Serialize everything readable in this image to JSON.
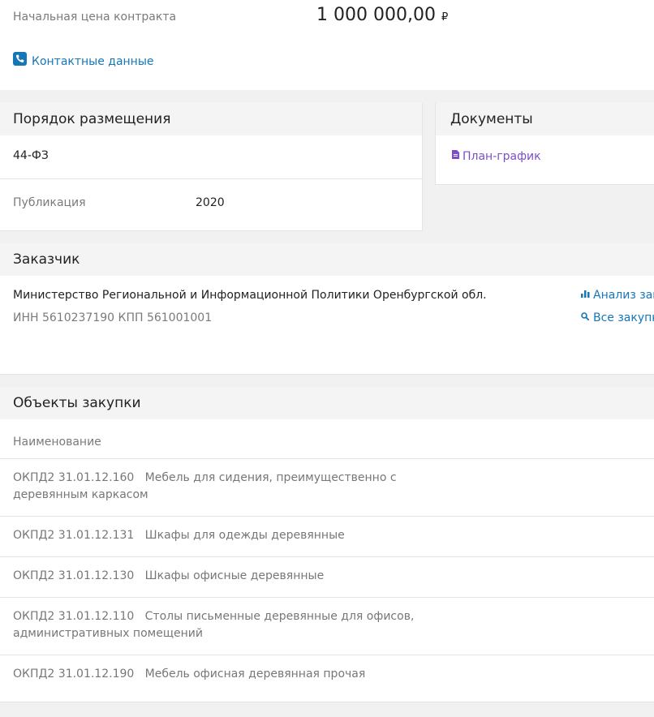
{
  "top": {
    "price_label": "Начальная цена контракта",
    "price_value": "1 000 000,00",
    "currency": "₽",
    "contacts_label": "Контактные данные"
  },
  "order": {
    "title": "Порядок размещения",
    "law": "44-ФЗ",
    "publication_label": "Публикация",
    "publication_value": "2020"
  },
  "documents": {
    "title": "Документы",
    "plan_link": "План-график"
  },
  "customer": {
    "title": "Заказчик",
    "name": "Министерство Региональной и Информационной Политики Оренбургской обл.",
    "inn_kpp": "ИНН 5610237190 КПП 561001001",
    "analysis_link": "Анализ зак",
    "all_link": "Все закупк"
  },
  "objects": {
    "title": "Объекты закупки",
    "column_header": "Наименование",
    "items": [
      {
        "code": "ОКПД2 31.01.12.160",
        "name": "Мебель для сидения, преимущественно с деревянным каркасом"
      },
      {
        "code": "ОКПД2 31.01.12.131",
        "name": "Шкафы для одежды деревянные"
      },
      {
        "code": "ОКПД2 31.01.12.130",
        "name": "Шкафы офисные деревянные"
      },
      {
        "code": "ОКПД2 31.01.12.110",
        "name": "Столы письменные деревянные для офисов, административных помещений"
      },
      {
        "code": "ОКПД2 31.01.12.190",
        "name": "Мебель офисная деревянная прочая"
      }
    ]
  },
  "colors": {
    "link_blue": "#1576b8",
    "document_purple": "#7b4fc9"
  }
}
